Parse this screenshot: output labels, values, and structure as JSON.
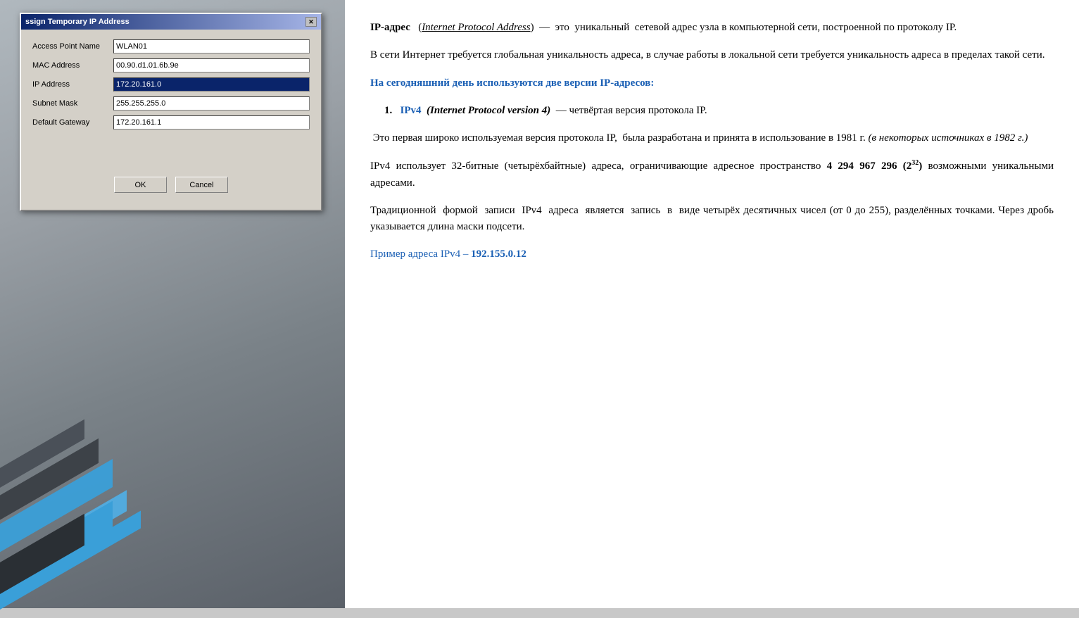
{
  "dialog": {
    "title": "ssign Temporary IP Address",
    "fields": [
      {
        "label": "Access Point Name",
        "value": "WLAN01",
        "selected": false
      },
      {
        "label": "MAC Address",
        "value": "00.90.d1.01.6b.9e",
        "selected": false
      },
      {
        "label": "IP Address",
        "value": "172.20.161.0",
        "selected": true
      },
      {
        "label": "Subnet Mask",
        "value": "255.255.255.0",
        "selected": false
      },
      {
        "label": "Default Gateway",
        "value": "172.20.161.1",
        "selected": false
      }
    ],
    "ok_label": "OK",
    "cancel_label": "Cancel"
  },
  "content": {
    "para1_part1": "IP-адрес",
    "para1_part2": "(Internet Protocol Address)",
    "para1_part3": "— это уникальный сетевой адрес узла в компьютерной сети, построенной по протоколу IP.",
    "para2": "В сети Интернет требуется глобальная уникальность адреса, в случае работы в локальной сети требуется уникальность адреса в пределах такой сети.",
    "blue_heading": "На сегодняшний день используются две версии IP-адресов:",
    "ipv4_label": "IPv4",
    "ipv4_italic": "(Internet Protocol version 4)",
    "ipv4_desc": "— четвёртая версия протокола IP.",
    "ipv4_para2": "Это первая широко используемая версия протокола IP,  была разработана и принята в использование в 1981 г.",
    "ipv4_italic2": "(в некоторых источниках в 1982 г.)",
    "ipv4_para3_1": "IPv4 использует 32-битные (четырёхбайтные) адреса, ограничивающие адресное пространство",
    "ipv4_bold": "4 294 967 296 (2",
    "ipv4_sup": "32",
    "ipv4_bold2": ")",
    "ipv4_para3_2": "возможными уникальными адресами.",
    "ipv4_para4": "Традиционной формой записи IPv4 адреса является запись в виде четырёх десятичных чисел (от 0 до 255), разделённых точками. Через дробь указывается длина маски подсети.",
    "ipv4_example_1": "Пример адреса IPv4 –",
    "ipv4_example_2": "192.155.0.12"
  }
}
